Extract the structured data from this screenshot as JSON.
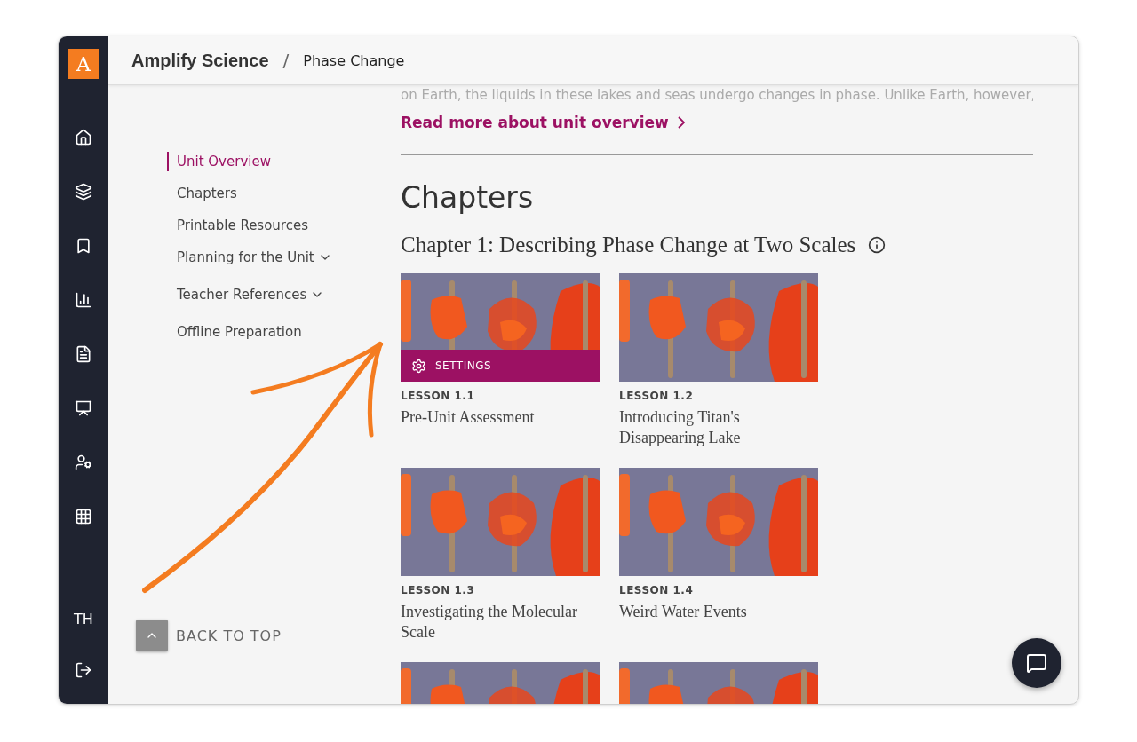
{
  "brand": {
    "logo_letter": "A",
    "title": "Amplify Science",
    "separator": "/",
    "page": "Phase Change"
  },
  "sidebar": {
    "user_initials": "TH"
  },
  "nav": [
    {
      "label": "Unit Overview",
      "selected": true,
      "kind": "link"
    },
    {
      "label": "Chapters",
      "selected": false,
      "kind": "link"
    },
    {
      "label": "Printable Resources",
      "selected": false,
      "kind": "link"
    },
    {
      "label": "Planning for the Unit",
      "selected": false,
      "kind": "dropdown"
    },
    {
      "label": "Teacher References",
      "selected": false,
      "kind": "dropdown"
    },
    {
      "label": "Offline Preparation",
      "selected": false,
      "kind": "link"
    }
  ],
  "back_to_top": "BACK TO TOP",
  "overview": {
    "text": "on Earth, the liquids in these lakes and seas undergo changes in phase. Unlike Earth, however,",
    "read_more": "Read more about unit overview"
  },
  "section_title": "Chapters",
  "chapter": {
    "title": "Chapter 1: Describing Phase Change at Two Scales",
    "lessons": [
      {
        "kind": "full",
        "number": "LESSON 1.1",
        "title": "Pre-Unit Assessment",
        "settings": "SETTINGS"
      },
      {
        "kind": "full",
        "number": "LESSON 1.2",
        "title": "Introducing Titan's Disappearing Lake"
      },
      {
        "kind": "full",
        "number": "LESSON 1.3",
        "title": "Investigating the Molecular Scale"
      },
      {
        "kind": "full",
        "number": "LESSON 1.4",
        "title": "Weird Water Events"
      },
      {
        "kind": "partial"
      },
      {
        "kind": "partial"
      }
    ]
  }
}
